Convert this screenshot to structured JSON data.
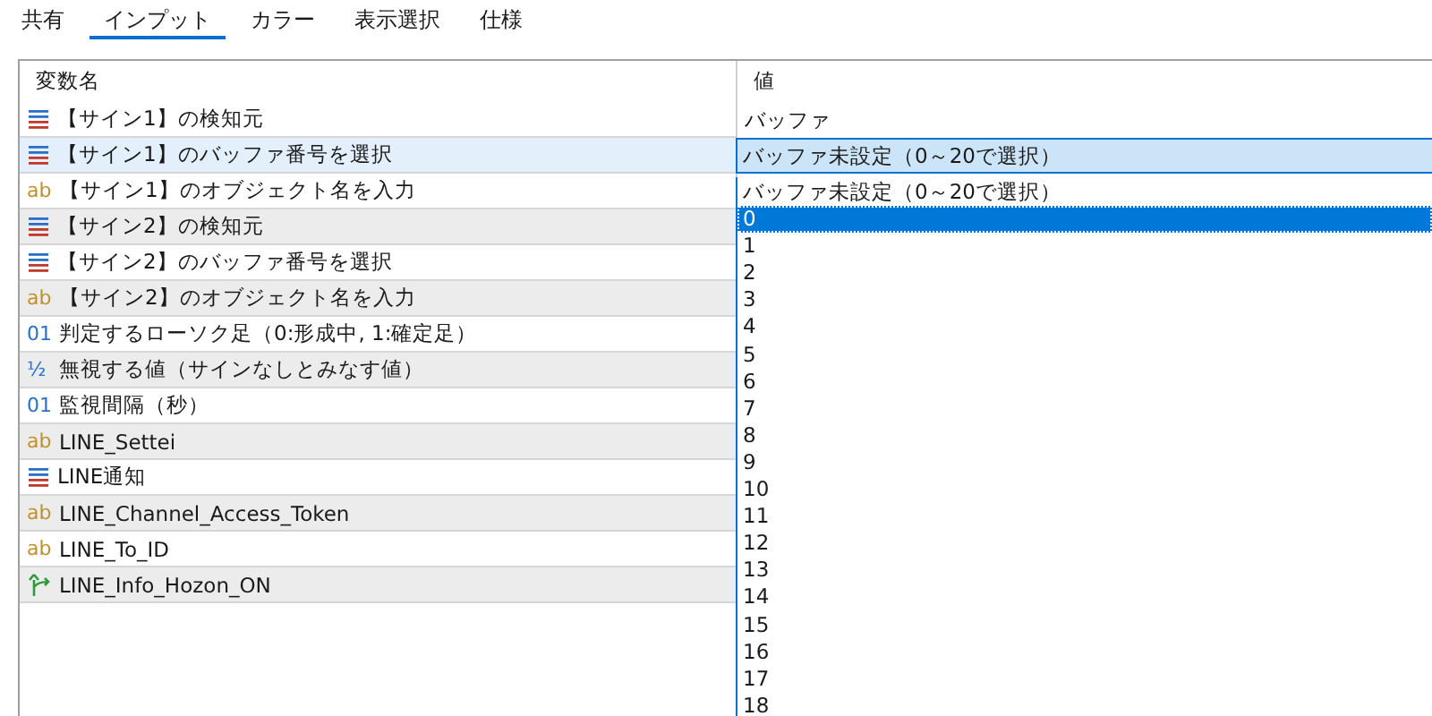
{
  "tabs": [
    {
      "label": "共有",
      "selected": false
    },
    {
      "label": "インプット",
      "selected": true
    },
    {
      "label": "カラー",
      "selected": false
    },
    {
      "label": "表示選択",
      "selected": false
    },
    {
      "label": "仕様",
      "selected": false
    }
  ],
  "table": {
    "columns": [
      "変数名",
      "値"
    ],
    "rows": [
      {
        "kind": "enum",
        "name": "【サイン1】の検知元",
        "value": "バッファ",
        "selected": false
      },
      {
        "kind": "enum",
        "name": "【サイン1】のバッファ番号を選択",
        "value": "バッファ未設定（0～20で選択）",
        "selected": true,
        "editing": true
      },
      {
        "kind": "string",
        "glyph": "ab",
        "name": "【サイン1】のオブジェクト名を入力",
        "selected": false
      },
      {
        "kind": "enum",
        "name": "【サイン2】の検知元",
        "selected": false
      },
      {
        "kind": "enum",
        "name": "【サイン2】のバッファ番号を選択",
        "selected": false
      },
      {
        "kind": "string",
        "glyph": "ab",
        "name": "【サイン2】のオブジェクト名を入力",
        "selected": false
      },
      {
        "kind": "int",
        "glyph": "01",
        "name": "判定するローソク足（0:形成中, 1:確定足）",
        "selected": false
      },
      {
        "kind": "double",
        "glyph": "½",
        "name": "無視する値（サインなしとみなす値）",
        "selected": false
      },
      {
        "kind": "int",
        "glyph": "01",
        "name": "監視間隔（秒）",
        "selected": false
      },
      {
        "kind": "string",
        "glyph": "ab",
        "name": "LINE_Settei",
        "selected": false
      },
      {
        "kind": "enum",
        "name": "LINE通知",
        "selected": false
      },
      {
        "kind": "string",
        "glyph": "ab",
        "name": "LINE_Channel_Access_Token",
        "selected": false
      },
      {
        "kind": "string",
        "glyph": "ab",
        "name": "LINE_To_ID",
        "selected": false
      },
      {
        "kind": "bool",
        "name": "LINE_Info_Hozon_ON",
        "selected": false
      }
    ]
  },
  "dropdown": {
    "options": [
      {
        "label": "バッファ未設定（0～20で選択）",
        "selected": false
      },
      {
        "label": "0",
        "selected": true
      },
      {
        "label": "1",
        "selected": false
      },
      {
        "label": "2",
        "selected": false
      },
      {
        "label": "3",
        "selected": false
      },
      {
        "label": "4",
        "selected": false
      },
      {
        "label": "5",
        "selected": false
      },
      {
        "label": "6",
        "selected": false
      },
      {
        "label": "7",
        "selected": false
      },
      {
        "label": "8",
        "selected": false
      },
      {
        "label": "9",
        "selected": false
      },
      {
        "label": "10",
        "selected": false
      },
      {
        "label": "11",
        "selected": false
      },
      {
        "label": "12",
        "selected": false
      },
      {
        "label": "13",
        "selected": false
      },
      {
        "label": "14",
        "selected": false
      },
      {
        "label": "15",
        "selected": false
      },
      {
        "label": "16",
        "selected": false
      },
      {
        "label": "17",
        "selected": false
      },
      {
        "label": "18",
        "selected": false
      }
    ]
  }
}
